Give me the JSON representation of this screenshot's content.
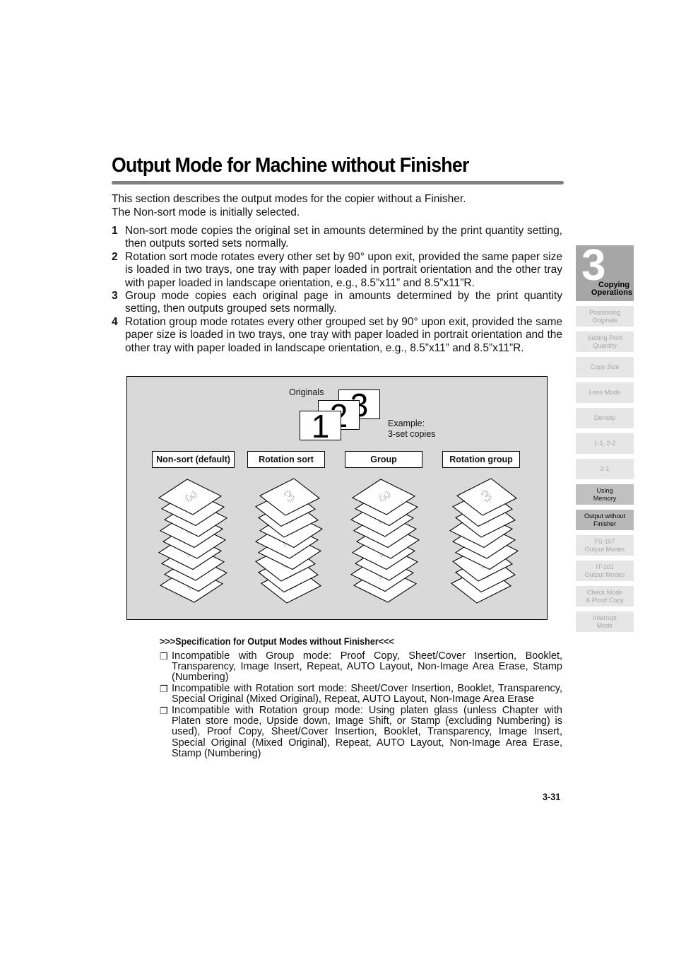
{
  "page": {
    "title": "Output Mode for Machine without Finisher",
    "intro": [
      "This section describes the output modes for the copier without a Finisher.",
      "The Non-sort mode is initially selected."
    ],
    "steps": [
      {
        "num": "1",
        "text": "Non-sort mode copies the original set in amounts determined by the print quantity setting, then outputs sorted sets normally."
      },
      {
        "num": "2",
        "text": "Rotation sort mode rotates every other set by 90° upon exit, provided the same paper size is loaded in two trays, one tray with paper loaded in portrait orientation and the other tray with paper loaded in landscape orientation, e.g., 8.5”x11” and 8.5”x11”R."
      },
      {
        "num": "3",
        "text": "Group mode copies each original page in amounts determined by the print quantity setting, then outputs grouped sets normally."
      },
      {
        "num": "4",
        "text": "Rotation group mode rotates every other grouped set by 90° upon exit, provided the same paper size is loaded in two trays, one tray with paper loaded in portrait orientation and the other tray with paper loaded in landscape orientation, e.g., 8.5”x11” and 8.5”x11”R."
      }
    ],
    "page_number": "3-31"
  },
  "figure": {
    "originals_label": "Originals",
    "original_pages": [
      "3",
      "2",
      "1"
    ],
    "example_label": "Example:",
    "example_sub": "3-set copies",
    "modes": [
      {
        "label": "Non-sort (default)",
        "stack": [
          "3",
          "2",
          "1",
          "3",
          "2",
          "1",
          "3",
          "2",
          "1"
        ],
        "rotate": [
          false,
          false,
          false,
          false,
          false,
          false,
          false,
          false,
          false
        ]
      },
      {
        "label": "Rotation sort",
        "stack": [
          "3",
          "2",
          "1",
          "3",
          "2",
          "1",
          "3",
          "2",
          "1"
        ],
        "rotate": [
          true,
          true,
          true,
          false,
          false,
          false,
          true,
          true,
          true
        ]
      },
      {
        "label": "Group",
        "stack": [
          "3",
          "3",
          "3",
          "2",
          "2",
          "2",
          "1",
          "1",
          "1"
        ],
        "rotate": [
          false,
          false,
          false,
          false,
          false,
          false,
          false,
          false,
          false
        ]
      },
      {
        "label": "Rotation group",
        "stack": [
          "3",
          "3",
          "3",
          "2",
          "2",
          "2",
          "1",
          "1",
          "1"
        ],
        "rotate": [
          true,
          true,
          true,
          false,
          false,
          false,
          true,
          true,
          true
        ]
      }
    ]
  },
  "spec": {
    "title": ">>>Specification for Output Modes without Finisher<<<",
    "bullet_glyph": "❒",
    "items": [
      "Incompatible with Group mode: Proof Copy, Sheet/Cover Insertion, Booklet, Transparency, Image Insert, Repeat, AUTO Layout, Non-Image Area Erase, Stamp (Numbering)",
      "Incompatible with Rotation sort mode: Sheet/Cover Insertion, Booklet, Transparency, Special Original (Mixed Original), Repeat, AUTO Layout, Non-Image Area Erase",
      "Incompatible with Rotation group mode: Using platen glass (unless Chapter with Platen store mode, Upside down, Image Shift, or Stamp (excluding Numbering) is used), Proof Copy, Sheet/Cover Insertion, Booklet, Transparency, Image Insert, Special Original (Mixed Original), Repeat, AUTO Layout, Non-Image Area Erase, Stamp (Numbering)"
    ]
  },
  "side_nav": {
    "chapter_number": "3",
    "chapter_label_line1": "Copying",
    "chapter_label_line2": "Operations",
    "items": [
      {
        "label": "Positioning\nOriginals",
        "state": "inactive"
      },
      {
        "label": "Setting Print\nQuantity",
        "state": "inactive"
      },
      {
        "label": "Copy Size",
        "state": "inactive"
      },
      {
        "label": "Lens Mode",
        "state": "inactive"
      },
      {
        "label": "Density",
        "state": "inactive"
      },
      {
        "label": "1-1, 2-2",
        "state": "inactive"
      },
      {
        "label": "2-1",
        "state": "inactive"
      },
      {
        "label": "Using\nMemory",
        "state": "section"
      },
      {
        "label": "Output without\nFinisher",
        "state": "active"
      },
      {
        "label": "FS-107\nOutput Modes",
        "state": "inactive"
      },
      {
        "label": "IT-101\nOutput Modes",
        "state": "inactive"
      },
      {
        "label": "Check Mode\n& Proof Copy",
        "state": "inactive"
      },
      {
        "label": "Interrupt\nMode",
        "state": "inactive"
      }
    ]
  }
}
